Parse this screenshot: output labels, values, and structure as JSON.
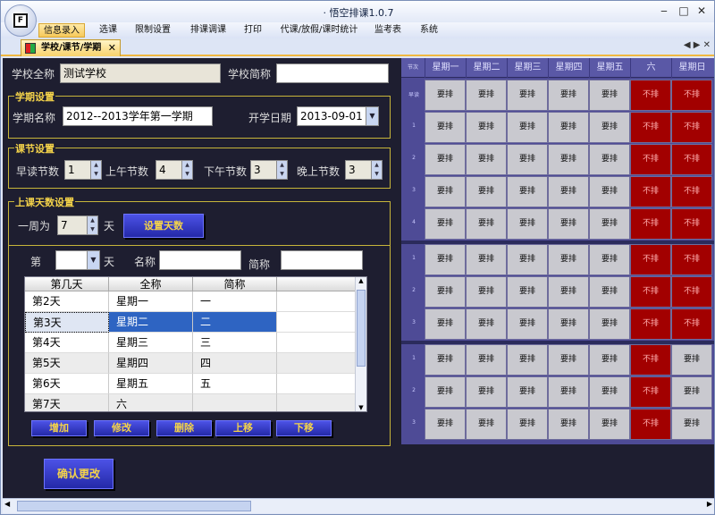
{
  "window": {
    "title": "· 悟空排课1.0.7",
    "controls": {
      "minimize": "‒",
      "maximize": "□",
      "close": "✕"
    }
  },
  "app_icon_letter": "F",
  "menu": [
    "信息录入",
    "选课",
    "限制设置",
    "排课调课",
    "打印",
    "代课/放假/课时统计",
    "监考表",
    "系统"
  ],
  "tab": {
    "label": "学校/课节/学期",
    "close": "✕",
    "nav": "◀ ▶ ✕"
  },
  "school": {
    "full_name_label": "学校全称",
    "full_name_value": "测试学校",
    "short_name_label": "学校简称",
    "short_name_value": ""
  },
  "semester": {
    "group_title": "学期设置",
    "name_label": "学期名称",
    "name_value": "2012--2013学年第一学期",
    "start_label": "开学日期",
    "start_value": "2013-09-01"
  },
  "periods": {
    "group_title": "课节设置",
    "early_label": "早读节数",
    "early_value": "1",
    "morning_label": "上午节数",
    "morning_value": "4",
    "afternoon_label": "下午节数",
    "afternoon_value": "3",
    "evening_label": "晚上节数",
    "evening_value": "3"
  },
  "days": {
    "group_title": "上课天数设置",
    "week_label": "一周为",
    "week_value": "7",
    "unit": "天",
    "set_button": "设置天数"
  },
  "day_edit": {
    "nth_label": "第",
    "nth_value": "",
    "unit": "天",
    "name_label": "名称",
    "name_value": "",
    "short_label": "简称",
    "short_value": ""
  },
  "table": {
    "headers": [
      "第几天",
      "全称",
      "简称"
    ],
    "rows": [
      {
        "day": "第2天",
        "full": "星期一",
        "short": "一"
      },
      {
        "day": "第3天",
        "full": "星期二",
        "short": "二"
      },
      {
        "day": "第4天",
        "full": "星期三",
        "short": "三"
      },
      {
        "day": "第5天",
        "full": "星期四",
        "short": "四"
      },
      {
        "day": "第6天",
        "full": "星期五",
        "short": "五"
      },
      {
        "day": "第7天",
        "full": "六",
        "short": ""
      }
    ]
  },
  "buttons": {
    "add": "增加",
    "edit": "修改",
    "delete": "删除",
    "up": "上移",
    "down": "下移",
    "confirm": "确认更改"
  },
  "grid": {
    "columns": [
      "星期一",
      "星期二",
      "星期三",
      "星期四",
      "星期五",
      "六",
      "星期日"
    ],
    "corner_label": "节次",
    "row_labels": [
      "早读",
      "1",
      "2",
      "3",
      "4",
      "1",
      "2",
      "3",
      "1",
      "2",
      "3"
    ],
    "cells": [
      [
        "要排",
        "要排",
        "要排",
        "要排",
        "要排",
        "不排",
        "不排"
      ],
      [
        "要排",
        "要排",
        "要排",
        "要排",
        "要排",
        "不排",
        "不排"
      ],
      [
        "要排",
        "要排",
        "要排",
        "要排",
        "要排",
        "不排",
        "不排"
      ],
      [
        "要排",
        "要排",
        "要排",
        "要排",
        "要排",
        "不排",
        "不排"
      ],
      [
        "要排",
        "要排",
        "要排",
        "要排",
        "要排",
        "不排",
        "不排"
      ],
      [
        "要排",
        "要排",
        "要排",
        "要排",
        "要排",
        "不排",
        "不排"
      ],
      [
        "要排",
        "要排",
        "要排",
        "要排",
        "要排",
        "不排",
        "不排"
      ],
      [
        "要排",
        "要排",
        "要排",
        "要排",
        "要排",
        "不排",
        "不排"
      ],
      [
        "要排",
        "要排",
        "要排",
        "要排",
        "要排",
        "不排",
        "要排"
      ],
      [
        "要排",
        "要排",
        "要排",
        "要排",
        "要排",
        "不排",
        "要排"
      ],
      [
        "要排",
        "要排",
        "要排",
        "要排",
        "要排",
        "不排",
        "要排"
      ]
    ],
    "colors": {
      "yes": "#c9c9cf",
      "no": "#a20000"
    }
  }
}
